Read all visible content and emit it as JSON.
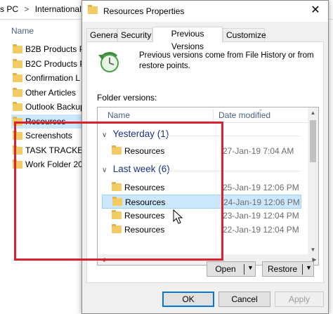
{
  "explorer": {
    "address_parts": [
      "s PC",
      ">",
      "International"
    ],
    "column_name": "Name",
    "items": [
      {
        "label": "B2B Products P",
        "selected": false
      },
      {
        "label": "B2C Products P",
        "selected": false
      },
      {
        "label": "Confirmation L",
        "selected": false
      },
      {
        "label": "Other Articles",
        "selected": false
      },
      {
        "label": "Outlook Backup",
        "selected": false
      },
      {
        "label": "Resources",
        "selected": true
      },
      {
        "label": "Screenshots",
        "selected": false
      },
      {
        "label": "TASK TRACKER",
        "selected": false
      },
      {
        "label": "Work Folder 20",
        "selected": false
      }
    ]
  },
  "dialog": {
    "title": "Resources Properties",
    "close_glyph": "✕",
    "tabs": [
      "General",
      "Security",
      "Previous Versions",
      "Customize"
    ],
    "active_tab": "Previous Versions",
    "info_text": "Previous versions come from File History or from restore points.",
    "folder_versions_label": "Folder versions:",
    "list": {
      "col_name": "Name",
      "col_date": "Date modified",
      "groups": [
        {
          "label": "Yesterday (1)",
          "rows": [
            {
              "name": "Resources",
              "date": "27-Jan-19 7:04 AM",
              "selected": false
            }
          ]
        },
        {
          "label": "Last week (6)",
          "rows": [
            {
              "name": "Resources",
              "date": "25-Jan-19 12:06 PM",
              "selected": false
            },
            {
              "name": "Resources",
              "date": "24-Jan-19 12:06 PM",
              "selected": true
            },
            {
              "name": "Resources",
              "date": "23-Jan-19 12:04 PM",
              "selected": false
            },
            {
              "name": "Resources",
              "date": "22-Jan-19 12:04 PM",
              "selected": false
            }
          ]
        }
      ]
    },
    "open_label": "Open",
    "restore_label": "Restore",
    "ok_label": "OK",
    "cancel_label": "Cancel",
    "apply_label": "Apply"
  },
  "colors": {
    "highlight": "#d9222e",
    "selection": "#cce8ff",
    "group_text": "#1e3287",
    "folder": "#f3cb64"
  }
}
